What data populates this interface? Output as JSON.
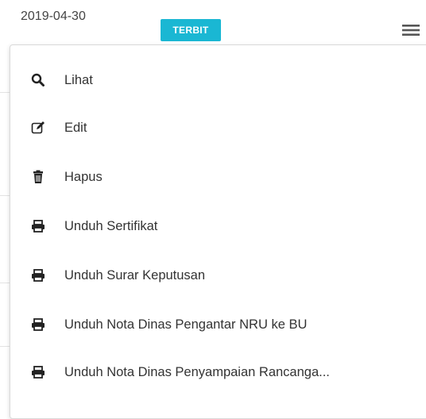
{
  "row": {
    "date": "2019-04-30",
    "status": "TERBIT"
  },
  "menu": {
    "items": [
      {
        "label": "Lihat",
        "icon": "search-icon"
      },
      {
        "label": "Edit",
        "icon": "edit-icon"
      },
      {
        "label": "Hapus",
        "icon": "trash-icon"
      },
      {
        "label": "Unduh Sertifikat",
        "icon": "print-icon"
      },
      {
        "label": "Unduh Surar Keputusan",
        "icon": "print-icon"
      },
      {
        "label": "Unduh Nota Dinas Pengantar NRU ke BU",
        "icon": "print-icon"
      },
      {
        "label": "Unduh Nota Dinas Penyampaian Rancanga...",
        "icon": "print-icon"
      }
    ]
  },
  "colors": {
    "badge": "#1ab7d3",
    "text": "#333333",
    "border": "#dadada"
  }
}
